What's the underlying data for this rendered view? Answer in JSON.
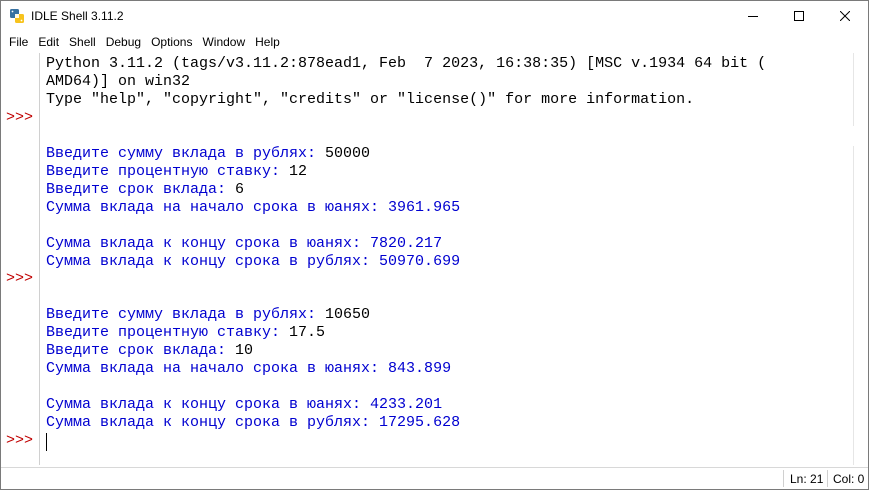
{
  "window": {
    "title": "IDLE Shell 3.11.2",
    "controls": {
      "minimize": "minimize-icon",
      "maximize": "maximize-icon",
      "close": "close-icon"
    }
  },
  "menu": {
    "items": [
      "File",
      "Edit",
      "Shell",
      "Debug",
      "Options",
      "Window",
      "Help"
    ]
  },
  "shell": {
    "prompt": ">>>",
    "banner": [
      "Python 3.11.2 (tags/v3.11.2:878ead1, Feb  7 2023, 16:38:35) [MSC v.1934 64 bit (",
      "AMD64)] on win32",
      "Type \"help\", \"copyright\", \"credits\" or \"license()\" for more information."
    ],
    "run1": {
      "q1": "Введите сумму вклада в рублях: ",
      "a1": "50000",
      "q2": "Введите процентную ставку: ",
      "a2": "12",
      "q3": "Введите срок вклада: ",
      "a3": "6",
      "out1": "Сумма вклада на начало срока в юанях: 3961.965",
      "out2": "Сумма вклада к концу срока в юанях: 7820.217",
      "out3": "Сумма вклада к концу срока в рублях: 50970.699"
    },
    "run2": {
      "q1": "Введите сумму вклада в рублях: ",
      "a1": "10650",
      "q2": "Введите процентную ставку: ",
      "a2": "17.5",
      "q3": "Введите срок вклада: ",
      "a3": "10",
      "out1": "Сумма вклада на начало срока в юанях: 843.899",
      "out2": "Сумма вклада к концу срока в юанях: 4233.201",
      "out3": "Сумма вклада к концу срока в рублях: 17295.628"
    }
  },
  "status": {
    "ln": "Ln: 21",
    "col": "Col: 0"
  },
  "colors": {
    "prompt": "#c00000",
    "output": "#0000d0",
    "input": "#000000"
  }
}
